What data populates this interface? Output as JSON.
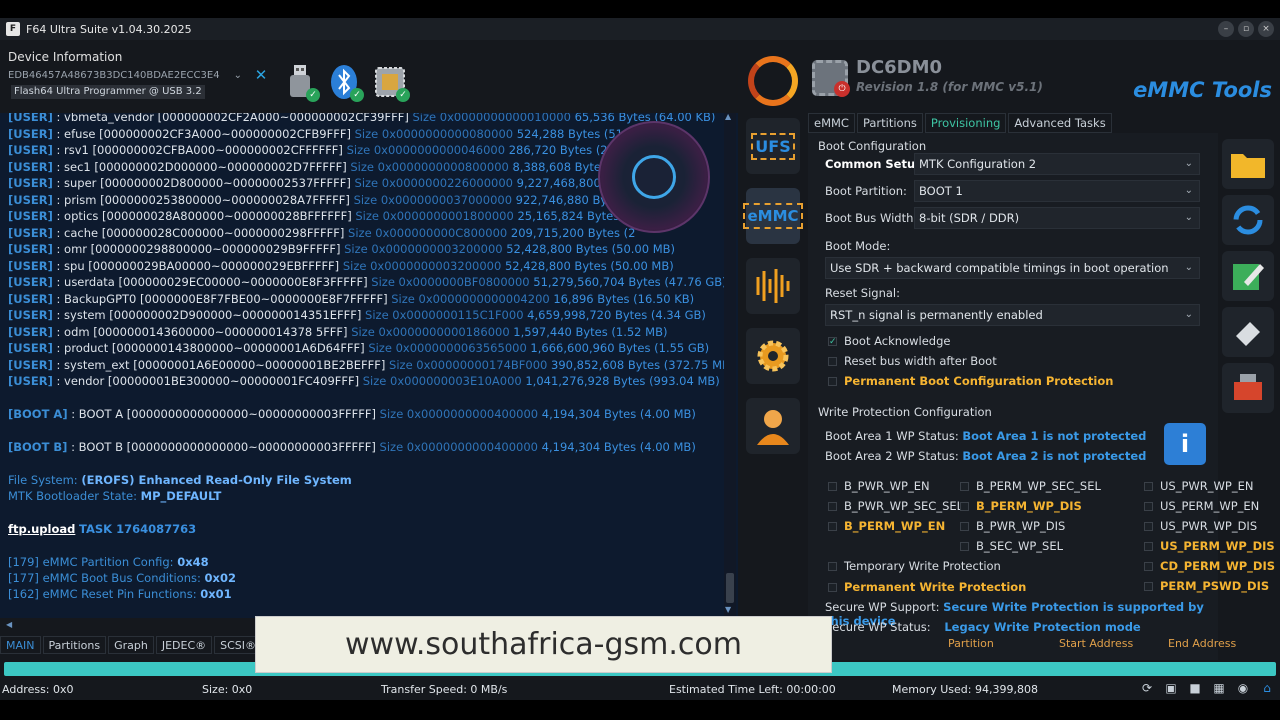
{
  "window": {
    "title": "F64 Ultra Suite v1.04.30.2025",
    "min": "–",
    "max": "▫",
    "close": "×"
  },
  "device": {
    "label": "Device Information",
    "id": "EDB46457A48673B3DC140BDAE2ECC3E4",
    "programmer": "Flash64 Ultra Programmer @ USB 3.2"
  },
  "log": {
    "user_lines": [
      {
        "tag": "[USER]",
        "name": ": vbmeta_vendor",
        "range": "[000000002CF2A000~000000002CF39FFF]",
        "size": "Size 0x0000000000010000",
        "bytes": "65,536 Bytes (64.00 KB)"
      },
      {
        "tag": "[USER]",
        "name": ": efuse",
        "range": "[000000002CF3A000~000000002CFB9FFF]",
        "size": "Size 0x0000000000080000",
        "bytes": "524,288 Bytes (512.0"
      },
      {
        "tag": "[USER]",
        "name": ": rsv1",
        "range": "[000000002CFBA000~000000002CFFFFFF]",
        "size": "Size 0x0000000000046000",
        "bytes": "286,720 Bytes (280.00"
      },
      {
        "tag": "[USER]",
        "name": ": sec1",
        "range": "[000000002D000000~000000002D7FFFFF]",
        "size": "Size 0x0000000000800000",
        "bytes": "8,388,608 Bytes (8.00"
      },
      {
        "tag": "[USER]",
        "name": ": super",
        "range": "[000000002D800000~00000002537FFFFF]",
        "size": "Size 0x0000000226000000",
        "bytes": "9,227,468,800 Bytes"
      },
      {
        "tag": "[USER]",
        "name": ": prism",
        "range": "[0000000253800000~000000028A7FFFFF]",
        "size": "Size 0x0000000037000000",
        "bytes": "922,746,880 Bytes (8"
      },
      {
        "tag": "[USER]",
        "name": ": optics",
        "range": "[000000028A800000~000000028BFFFFFF]",
        "size": "Size 0x0000000001800000",
        "bytes": "25,165,824 Bytes (24"
      },
      {
        "tag": "[USER]",
        "name": ": cache",
        "range": "[000000028C000000~0000000298FFFFF]",
        "size": "Size 0x000000000C800000",
        "bytes": "209,715,200 Bytes (2"
      },
      {
        "tag": "[USER]",
        "name": ": omr",
        "range": "[0000000298800000~000000029B9FFFFF]",
        "size": "Size 0x0000000003200000",
        "bytes": "52,428,800 Bytes (50.00 MB)"
      },
      {
        "tag": "[USER]",
        "name": ": spu",
        "range": "[000000029BA00000~000000029EBFFFFF]",
        "size": "Size 0x0000000003200000",
        "bytes": "52,428,800 Bytes (50.00 MB)"
      },
      {
        "tag": "[USER]",
        "name": ": userdata",
        "range": "[000000029EC00000~0000000E8F3FFFFF]",
        "size": "Size 0x0000000BF0800000",
        "bytes": "51,279,560,704 Bytes (47.76 GB)"
      },
      {
        "tag": "[USER]",
        "name": ": BackupGPT0",
        "range": "[0000000E8F7FBE00~0000000E8F7FFFFF]",
        "size": "Size 0x0000000000004200",
        "bytes": "16,896 Bytes (16.50 KB)"
      },
      {
        "tag": "[USER]",
        "name": ": system",
        "range": "[000000002D900000~000000014351EFFF]",
        "size": "Size 0x0000000115C1F000",
        "bytes": "4,659,998,720 Bytes (4.34 GB)"
      },
      {
        "tag": "[USER]",
        "name": ": odm",
        "range": "[0000000143600000~000000014378 5FFF]",
        "size": "Size 0x0000000000186000",
        "bytes": "1,597,440 Bytes (1.52 MB)"
      },
      {
        "tag": "[USER]",
        "name": ": product",
        "range": "[0000000143800000~00000001A6D64FFF]",
        "size": "Size 0x0000000063565000",
        "bytes": "1,666,600,960 Bytes (1.55 GB)"
      },
      {
        "tag": "[USER]",
        "name": ": system_ext",
        "range": "[00000001A6E00000~00000001BE2BEFFF]",
        "size": "Size 0x00000000174BF000",
        "bytes": "390,852,608 Bytes (372.75 MB)"
      },
      {
        "tag": "[USER]",
        "name": ": vendor",
        "range": "[00000001BE300000~00000001FC409FFF]",
        "size": "Size 0x000000003E10A000",
        "bytes": "1,041,276,928 Bytes (993.04 MB)"
      }
    ],
    "boot_a": {
      "tag": "[BOOT A]",
      "name": ": BOOT A",
      "range": "[0000000000000000~00000000003FFFFF]",
      "size": "Size 0x0000000000400000",
      "bytes": "4,194,304 Bytes (4.00 MB)"
    },
    "boot_b": {
      "tag": "[BOOT B]",
      "name": ": BOOT B",
      "range": "[0000000000000000~00000000003FFFFF]",
      "size": "Size 0x0000000000400000",
      "bytes": "4,194,304 Bytes (4.00 MB)"
    },
    "fs_label": "File System:",
    "fs_value": "(EROFS) Enhanced Read-Only File System",
    "bl_label": "MTK Bootloader State:",
    "bl_value": "MP_DEFAULT",
    "ftp": "ftp.upload",
    "task": "TASK 1764087763",
    "cfg": [
      {
        "label": "[179] eMMC Partition Config:",
        "value": "0x48"
      },
      {
        "label": "[177] eMMC Boot Bus Conditions:",
        "value": "0x02"
      },
      {
        "label": "[162] eMMC Reset Pin Functions:",
        "value": "0x01"
      }
    ]
  },
  "bottom_tabs": [
    "MAIN",
    "Partitions",
    "Graph",
    "JEDEC®",
    "SCSI®"
  ],
  "mid_icons": [
    "UFS",
    "eMMC"
  ],
  "header": {
    "model": "DC6DM0",
    "revision": "Revision 1.8 (for MMC v5.1)",
    "brand": "eMMC Tools"
  },
  "tabs": [
    "eMMC",
    "Partitions",
    "Provisioning",
    "Advanced Tasks"
  ],
  "boot_config": {
    "title": "Boot Configuration",
    "common_setup_label": "Common Setup:",
    "common_setup": "MTK Configuration 2",
    "boot_partition_label": "Boot Partition:",
    "boot_partition": "BOOT 1",
    "bus_width_label": "Boot Bus Width:",
    "bus_width": "8-bit (SDR / DDR)",
    "boot_mode_label": "Boot Mode:",
    "boot_mode": "Use SDR + backward compatible timings in boot operation",
    "reset_label": "Reset Signal:",
    "reset": "RST_n signal is permanently enabled",
    "ack": "Boot Acknowledge",
    "reset_bus": "Reset bus width after Boot",
    "perm_protect": "Permanent Boot Configuration Protection"
  },
  "wp_config": {
    "title": "Write Protection Configuration",
    "area1_label": "Boot Area 1 WP Status:",
    "area1": "Boot Area 1 is not protected",
    "area2_label": "Boot Area 2 WP Status:",
    "area2": "Boot Area 2 is not protected",
    "flags": {
      "c1": [
        "B_PWR_WP_EN",
        "B_PWR_WP_SEC_SEL",
        "B_PERM_WP_EN"
      ],
      "c2": [
        "B_PERM_WP_SEC_SEL",
        "B_PERM_WP_DIS",
        "B_PWR_WP_DIS",
        "B_SEC_WP_SEL"
      ],
      "c3": [
        "US_PWR_WP_EN",
        "US_PERM_WP_EN",
        "US_PWR_WP_DIS",
        "US_PERM_WP_DIS",
        "CD_PERM_WP_DIS",
        "PERM_PSWD_DIS"
      ]
    },
    "temp_wp": "Temporary Write Protection",
    "perm_wp": "Permanent Write Protection",
    "secure_support_label": "Secure WP Support:",
    "secure_support": "Secure Write Protection is supported by this device",
    "secure_status_label": "Secure WP Status:",
    "secure_status": "Legacy Write Protection mode",
    "col_partition": "Partition",
    "col_start": "Start Address",
    "col_end": "End Address"
  },
  "info_icon": "i",
  "watermark": "www.southafrica-gsm.com",
  "progress": 1.0,
  "status": {
    "address": "Address: 0x0",
    "size": "Size: 0x0",
    "speed": "Transfer Speed: 0 MB/s",
    "eta": "Estimated Time Left: 00:00:00",
    "memory": "Memory Used: 94,399,808"
  },
  "colors": {
    "accent": "#2b8de0",
    "warn": "#f5b432",
    "progress": "#3cc7c3"
  }
}
